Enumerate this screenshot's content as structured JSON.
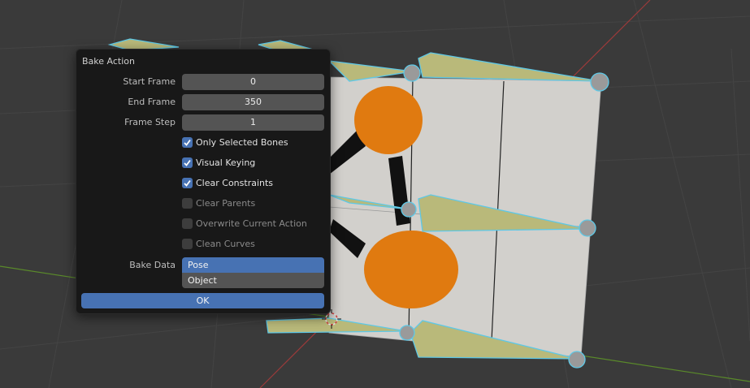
{
  "dialog": {
    "title": "Bake Action",
    "start_frame": {
      "label": "Start Frame",
      "value": "0"
    },
    "end_frame": {
      "label": "End Frame",
      "value": "350"
    },
    "frame_step": {
      "label": "Frame Step",
      "value": "1"
    },
    "options": [
      {
        "label": "Only Selected Bones",
        "checked": true,
        "enabled": true
      },
      {
        "label": "Visual Keying",
        "checked": true,
        "enabled": true
      },
      {
        "label": "Clear Constraints",
        "checked": true,
        "enabled": true
      },
      {
        "label": "Clear Parents",
        "checked": false,
        "enabled": false
      },
      {
        "label": "Overwrite Current Action",
        "checked": false,
        "enabled": false
      },
      {
        "label": "Clean Curves",
        "checked": false,
        "enabled": false
      }
    ],
    "bake_data": {
      "label": "Bake Data",
      "selected": "Pose",
      "other": "Object"
    },
    "ok_label": "OK"
  },
  "colors": {
    "accent": "#4772b3",
    "panel_bg": "#181818",
    "field_bg": "#545454",
    "viewport_bg": "#3a3a3a",
    "bone_fill": "#b9b97a",
    "bone_outline": "#5ec8e6",
    "mesh_fill": "#d2d0cc",
    "disc_orange": "#e07a10"
  }
}
